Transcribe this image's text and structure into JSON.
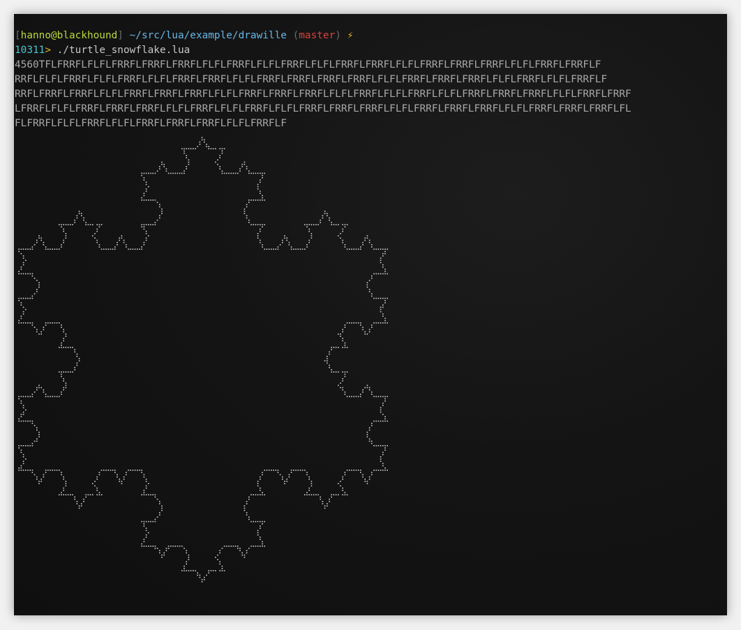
{
  "prompt": {
    "bracket_open": "[",
    "user_host": "hanno@blackhound",
    "bracket_close": "]",
    "cwd": "~/src/lua/example/drawille",
    "paren_open": "(",
    "branch": "master",
    "paren_close": ")",
    "status_icon": "⚡",
    "history_number": "10311",
    "prompt_arrow": ">",
    "command": "./turtle_snowflake.lua"
  },
  "output": {
    "lines": [
      "4560TFLFRRFLFLFLFRRFLFRRFLFRRFLFLFLFRRFLFLFLFRRFLFLFLFRRFLFRRFLFLFLFRRFLFRRFLFRRFLFLFLFRRFLFRRFLF",
      "RRFLFLFLFRRFLFLFLFRRFLFLFLFRRFLFRRFLFLFLFRRFLFRRFLFRRFLFRRFLFLFLFRRFLFRRFLFRRFLFLFLFRRFLFLFLFRRFLF",
      "RRFLFRRFLFRRFLFLFLFRRFLFRRFLFRRFLFLFLFRRFLFRRFLFRRFLFLFLFRRFLFLFLFRRFLFLFLFRRFLFRRFLFRRFLFLFLFRRFLFRRF",
      "LFRRFLFLFLFRRFLFRRFLFRRFLFLFLFRRFLFLFLFRRFLFLFLFRRFLFRRFLFRRFLFLFLFRRFLFRRFLFRRFLFLFLFRRFLFRRFLFRRFLFL",
      "FLFRRFLFLFLFRRFLFLFLFRRFLFRRFLFRRFLFLFLFRRFLF"
    ]
  },
  "colors": {
    "user_host": "#b7d83c",
    "path": "#68b6e6",
    "branch": "#d8423b",
    "status_icon": "#e3b424",
    "history_number": "#4bc6d0",
    "braille_dots": "#cfcfcf"
  },
  "drawing": {
    "description_icon": "koch-snowflake-braille-art"
  }
}
